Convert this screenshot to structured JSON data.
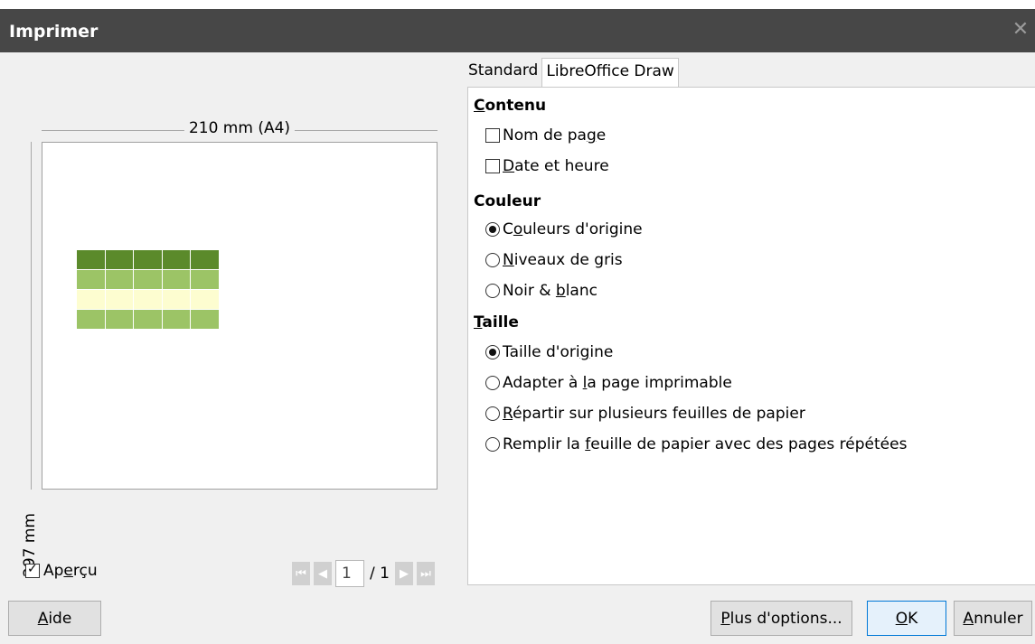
{
  "window": {
    "title": "Imprimer",
    "close_glyph": "✕"
  },
  "preview": {
    "width_label": "210 mm (A4)",
    "height_label": "297 mm",
    "show_preview_label": "Aperçu",
    "show_preview_checked": true,
    "page_current": "1",
    "page_total": "/ 1",
    "grid_colors": {
      "dark": "#5b8a2b",
      "medium": "#9cc466",
      "light": "#fdfdd0"
    },
    "nav_icons": [
      "first-page-icon",
      "previous-page-icon",
      "next-page-icon",
      "last-page-icon"
    ]
  },
  "tabs": [
    {
      "label": "Standard",
      "active": false
    },
    {
      "label": "LibreOffice Draw",
      "active": true
    }
  ],
  "panel": {
    "contenu": {
      "title_u": "C",
      "title_rest": "ontenu",
      "options": [
        {
          "u": "",
          "pre": "Nom de pa",
          "uch": "g",
          "post": "e",
          "checked": false
        },
        {
          "pre": "",
          "uch": "D",
          "post": "ate et heure",
          "checked": false
        }
      ]
    },
    "couleur": {
      "title": "Couleur",
      "options": [
        {
          "pre": "C",
          "uch": "o",
          "post": "uleurs d'origine",
          "checked": true
        },
        {
          "pre": "",
          "uch": "N",
          "post": "iveaux de gris",
          "checked": false
        },
        {
          "pre": "Noir & ",
          "uch": "b",
          "post": "lanc",
          "checked": false
        }
      ]
    },
    "taille": {
      "title_u": "T",
      "title_rest": "aille",
      "options": [
        {
          "pre": "Taille d'ori",
          "uch": "g",
          "post": "ine",
          "checked": true
        },
        {
          "pre": "Adapter à ",
          "uch": "l",
          "post": "a page imprimable",
          "checked": false
        },
        {
          "pre": "",
          "uch": "R",
          "post": "épartir sur plusieurs feuilles de papier",
          "checked": false
        },
        {
          "pre": "Remplir la ",
          "uch": "f",
          "post": "euille de papier avec des pages répétées",
          "checked": false
        }
      ]
    }
  },
  "buttons": {
    "help_u": "A",
    "help_rest": "ide",
    "more_u": "P",
    "more_rest": "lus d'options...",
    "ok_u": "O",
    "ok_rest": "K",
    "cancel_u": "A",
    "cancel_rest": "nnuler"
  }
}
